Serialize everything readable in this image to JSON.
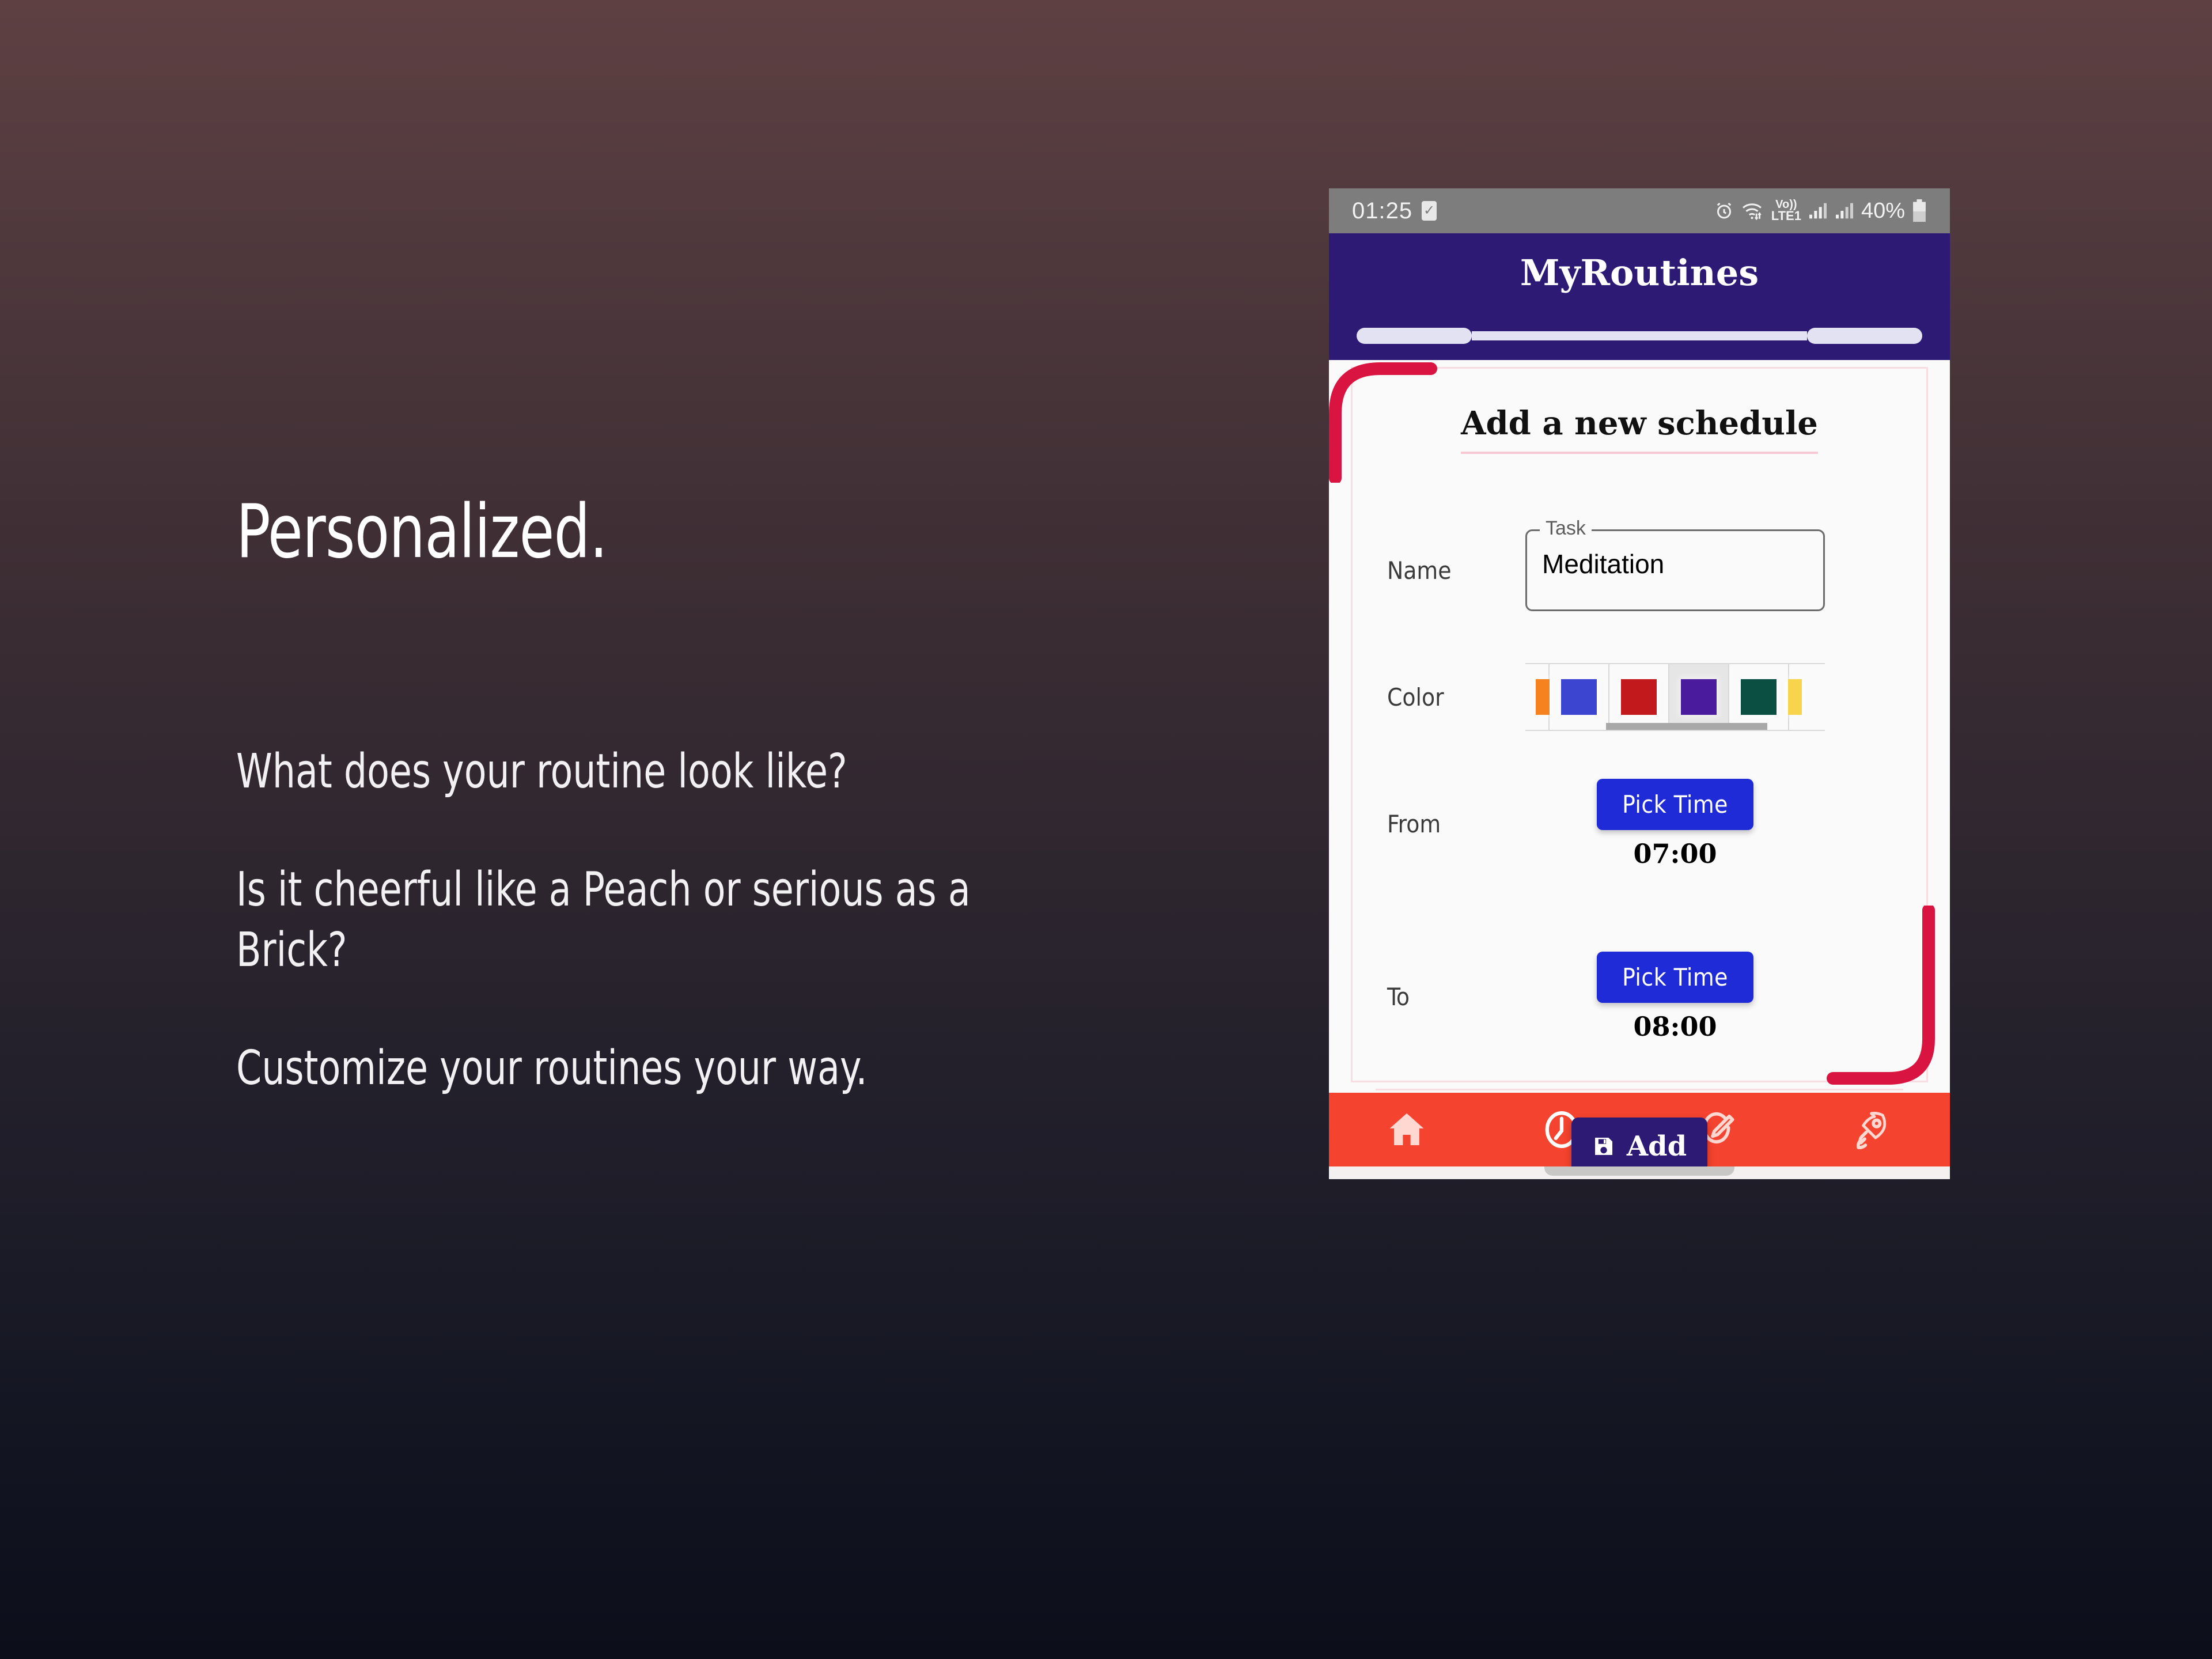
{
  "promo": {
    "title": "Personalized.",
    "paragraphs": [
      "What does your routine look like?",
      "Is it cheerful like a Peach or serious as a Brick?",
      "Customize your routines your way."
    ]
  },
  "phone": {
    "statusbar": {
      "time": "01:25",
      "check_icon": "checkbox-icon",
      "alarm_icon": "alarm-icon",
      "wifi_icon": "wifi-icon",
      "volte_top": "Vo))",
      "volte_bottom": "LTE1",
      "signal1_icon": "signal-bars-icon",
      "signal2_icon": "signal-bars-icon",
      "battery_text": "40%",
      "battery_icon": "battery-icon"
    },
    "appbar": {
      "title": "MyRoutines"
    },
    "card": {
      "heading": "Add a new schedule",
      "name": {
        "label": "Name",
        "field_legend": "Task",
        "value": "Meditation"
      },
      "color": {
        "label": "Color",
        "swatches": [
          {
            "name": "orange",
            "hex": "#f5821f",
            "selected": false
          },
          {
            "name": "blue",
            "hex": "#3b45cf",
            "selected": false
          },
          {
            "name": "red",
            "hex": "#c2191c",
            "selected": false
          },
          {
            "name": "purple",
            "hex": "#4a1b9d",
            "selected": true
          },
          {
            "name": "green",
            "hex": "#0a4f42",
            "selected": false
          },
          {
            "name": "yellow",
            "hex": "#f8d44c",
            "selected": false
          }
        ]
      },
      "from": {
        "label": "From",
        "button": "Pick Time",
        "value": "07:00"
      },
      "to": {
        "label": "To",
        "button": "Pick Time",
        "value": "08:00"
      },
      "add": {
        "label": "Add",
        "icon": "save-floppy-icon"
      }
    },
    "bottomnav": {
      "items": [
        {
          "name": "home-icon"
        },
        {
          "name": "clock-icon"
        },
        {
          "name": "edit-pencil-icon"
        },
        {
          "name": "rocket-icon"
        }
      ]
    }
  },
  "colors": {
    "accent_red": "#d91440",
    "appbar_purple": "#2c1a75",
    "nav_red": "#f4432f",
    "pick_blue": "#1f2bd6",
    "card_border_pink": "#fadde3"
  }
}
